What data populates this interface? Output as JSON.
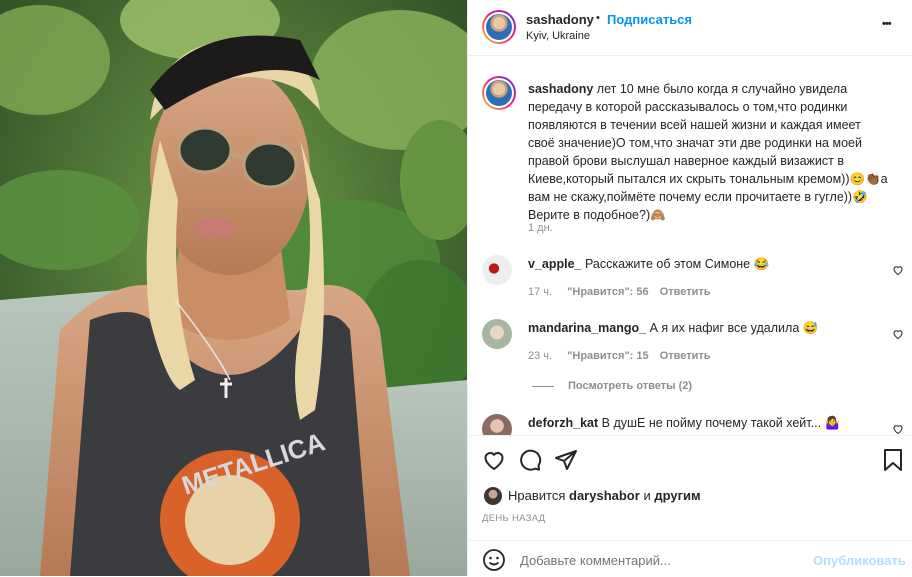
{
  "post": {
    "username": "sashadony",
    "follow_label": "Подписаться",
    "dot": "•",
    "location": "Kyiv, Ukraine",
    "more_label": "•••",
    "caption_text": "лет 10 мне было когда я случайно увидела передачу в которой рассказывалось о том,что родинки появляются в течении всей нашей жизни и каждая имеет своё значение)О том,что значат эти две родинки на моей правой брови выслушал наверное каждый визажист в Киеве,который пытался их скрыть тональным кремом))😊👏🏾а вам не скажу,поймёте почему если прочитаете в гугле))🤣 Верите в подобное?)🙈",
    "caption_time": "1 дн."
  },
  "comments": [
    {
      "user": "v_apple_",
      "text": "Расскажите об этом Симоне 😂",
      "time": "17 ч.",
      "likes": "\"Нравится\": 56",
      "reply": "Ответить"
    },
    {
      "user": "mandarina_mango_",
      "text": "А я их нафиг все удалила 😅",
      "time": "23 ч.",
      "likes": "\"Нравится\": 15",
      "reply": "Ответить"
    },
    {
      "user": "deforzh_kat",
      "text": "В душЕ не пойму почему такой хейт... 🤷‍♀️"
    }
  ],
  "view_replies": "Посмотреть ответы (2)",
  "likes": {
    "prefix": "Нравится",
    "user": "daryshabor",
    "and": "и",
    "others": "другим"
  },
  "date_label": "ДЕНЬ НАЗАД",
  "composer": {
    "placeholder": "Добавьте комментарий...",
    "publish": "Опубликовать"
  },
  "photo": {
    "shirt_text": "METALLICA"
  }
}
